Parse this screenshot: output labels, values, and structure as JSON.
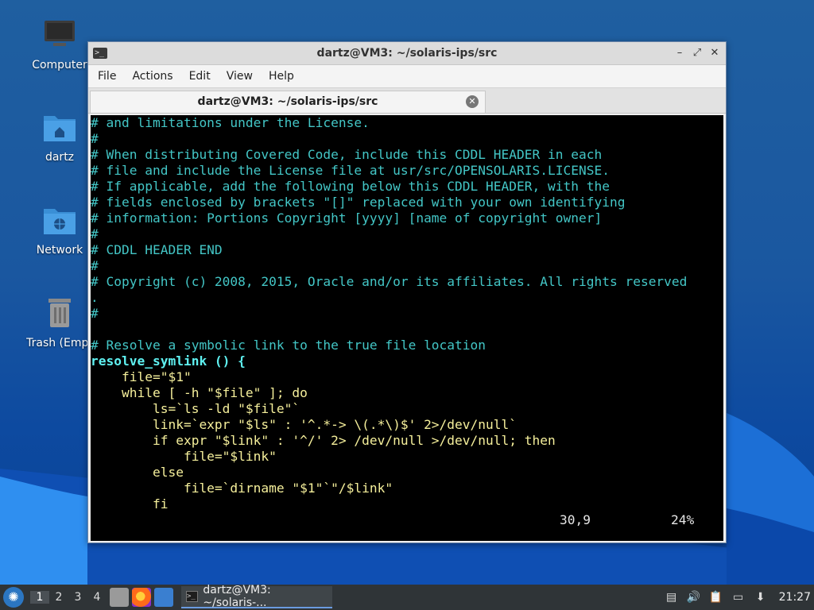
{
  "desktop": {
    "icons": [
      {
        "label": "Computer",
        "icon": "computer-icon"
      },
      {
        "label": "dartz",
        "icon": "home-folder-icon"
      },
      {
        "label": "Network",
        "icon": "network-folder-icon"
      },
      {
        "label": "Trash (Empt",
        "icon": "trash-icon"
      }
    ]
  },
  "window": {
    "title": "dartz@VM3: ~/solaris-ips/src",
    "menu": [
      "File",
      "Actions",
      "Edit",
      "View",
      "Help"
    ],
    "tab_label": "dartz@VM3: ~/solaris-ips/src"
  },
  "terminal": {
    "lines": [
      "# and limitations under the License.",
      "#",
      "# When distributing Covered Code, include this CDDL HEADER in each",
      "# file and include the License file at usr/src/OPENSOLARIS.LICENSE.",
      "# If applicable, add the following below this CDDL HEADER, with the",
      "# fields enclosed by brackets \"[]\" replaced with your own identifying",
      "# information: Portions Copyright [yyyy] [name of copyright owner]",
      "#",
      "# CDDL HEADER END",
      "#",
      "# Copyright (c) 2008, 2015, Oracle and/or its affiliates. All rights reserved",
      ".",
      "#",
      "",
      "# Resolve a symbolic link to the true file location",
      "resolve_symlink () {",
      "    file=\"$1\"",
      "    while [ -h \"$file\" ]; do",
      "        ls=`ls -ld \"$file\"`",
      "        link=`expr \"$ls\" : '^.*-> \\(.*\\)$' 2>/dev/null`",
      "        if expr \"$link\" : '^/' 2> /dev/null >/dev/null; then",
      "            file=\"$link\"",
      "        else",
      "            file=`dirname \"$1\"`\"/$link\"",
      "        fi"
    ],
    "cursor_position": "30,9",
    "scroll_percent": "24%"
  },
  "taskbar": {
    "workspaces": [
      "1",
      "2",
      "3",
      "4"
    ],
    "active_workspace": "1",
    "task_label": "dartz@VM3: ~/solaris-...",
    "clock": "21:27"
  }
}
